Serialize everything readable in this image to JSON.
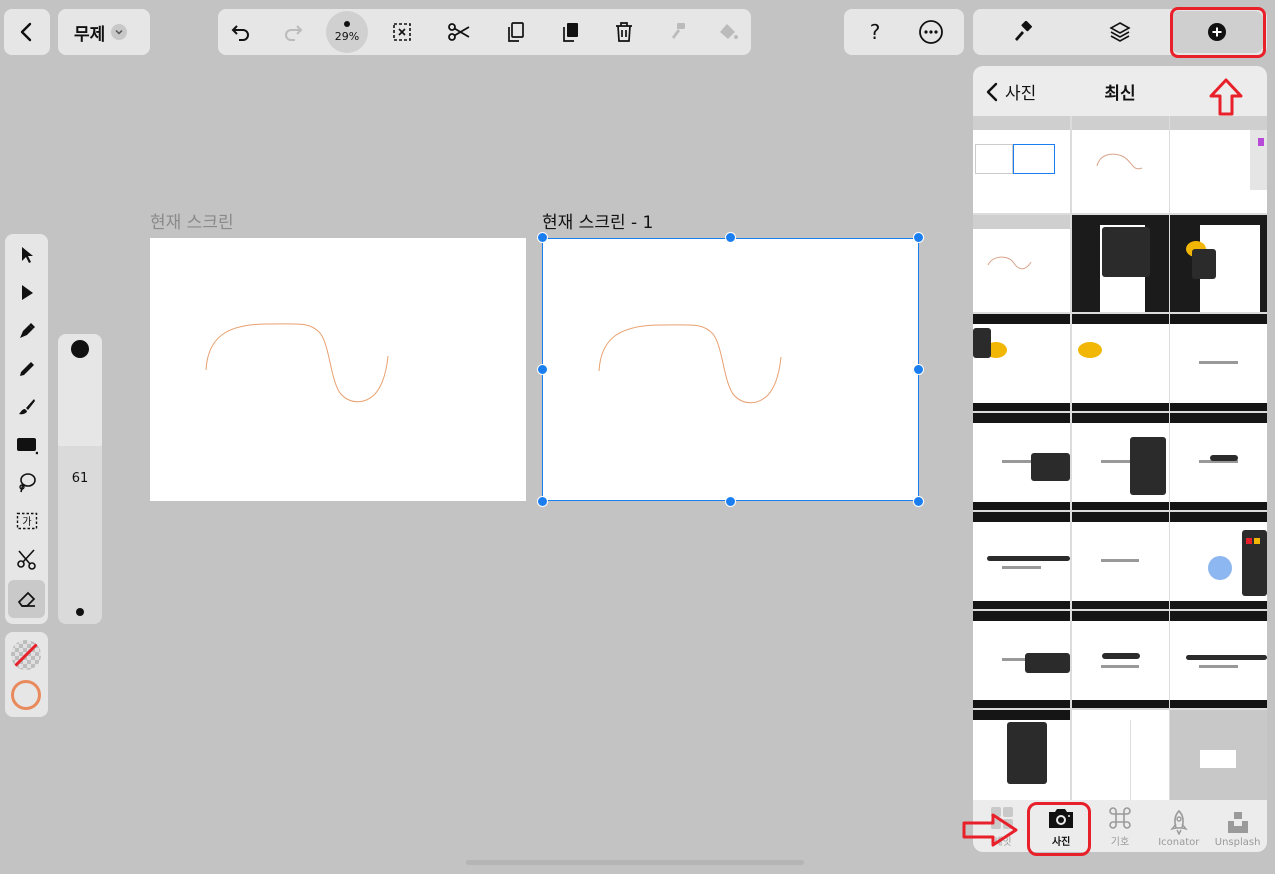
{
  "top_bar": {
    "document_title": "무제",
    "zoom": "29%"
  },
  "artboards": [
    {
      "label": "현재 스크린"
    },
    {
      "label": "현재 스크린 - 1"
    }
  ],
  "brush_size": "61",
  "panel": {
    "back_label": "사진",
    "title": "최신",
    "bottom_tabs": [
      {
        "label": "셰잇",
        "icon": "grid-icon"
      },
      {
        "label": "사진",
        "icon": "camera-icon"
      },
      {
        "label": "기호",
        "icon": "command-icon"
      },
      {
        "label": "Iconator",
        "icon": "rocket-icon"
      },
      {
        "label": "Unsplash",
        "icon": "unsplash-icon"
      }
    ]
  },
  "colors": {
    "accent_blue": "#1b7ef0",
    "highlight_red": "#e8202a",
    "stroke_orange": "#e8a070"
  }
}
